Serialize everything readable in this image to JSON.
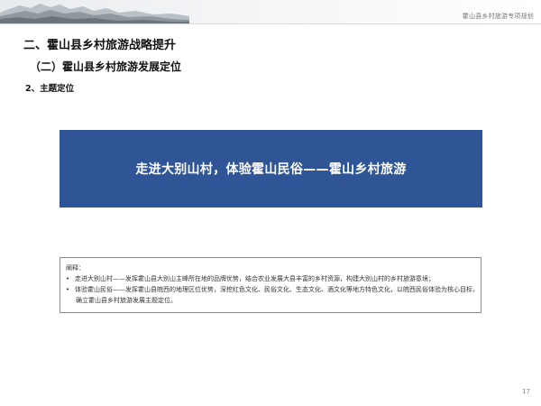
{
  "header": {
    "label": "霍山县乡村旅游专项规划"
  },
  "section": {
    "title": "二、霍山县乡村旅游战略提升",
    "subtitle": "（二）霍山县乡村旅游发展定位",
    "item": "2、主题定位"
  },
  "banner": {
    "slogan": "走进大别山村，体验霍山民俗——霍山乡村旅游"
  },
  "note": {
    "title": "阐释：",
    "items": [
      {
        "bullet": "•",
        "line1": "走进大别山村——发挥霍山县大别山主峰所在地的品牌优势，结合农业发展大县丰富的乡村资源，构建大别山村的乡村旅游意境；",
        "line2": ""
      },
      {
        "bullet": "•",
        "line1": "体验霍山民俗——发挥霍山县皖西的地理区位优势，深挖红色文化、民俗文化、生态文化、酒文化等地方特色文化，以皖西民俗体验为核心目标，",
        "line2": "确立霍山县乡村旅游发展主题定位。"
      }
    ]
  },
  "page": {
    "number": "17"
  },
  "colors": {
    "banner": "#2f5597",
    "banner_text": "#ffffff"
  }
}
